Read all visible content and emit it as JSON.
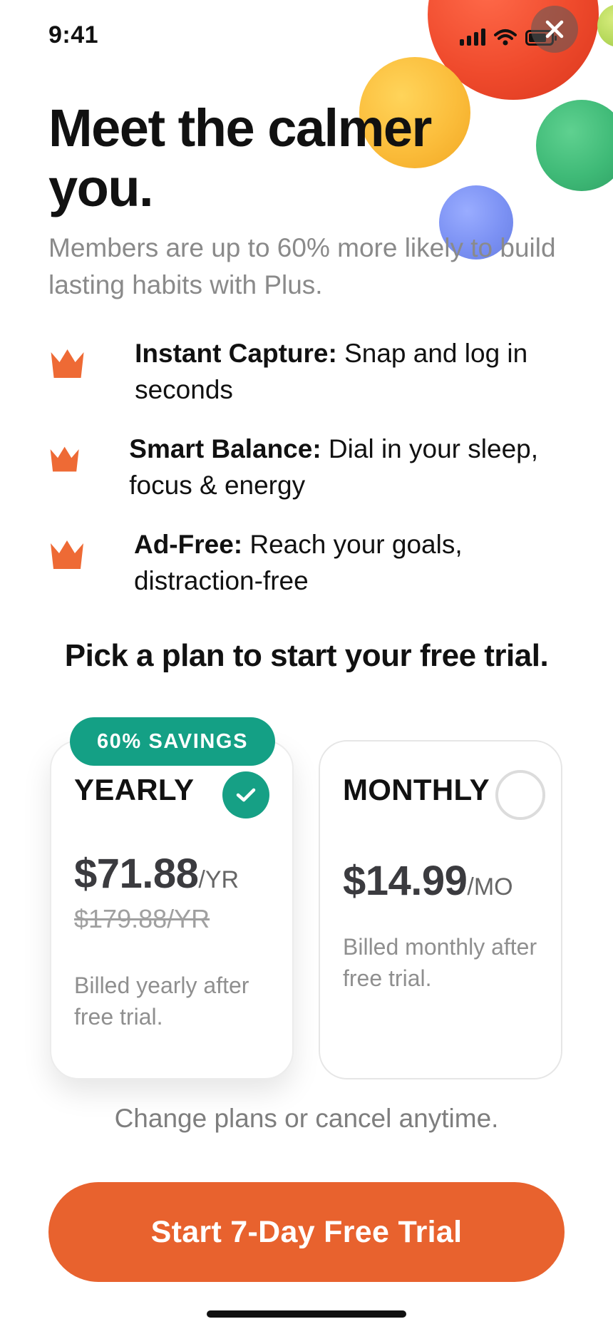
{
  "status_bar": {
    "time": "9:41",
    "icons": [
      "signal-icon",
      "wifi-icon",
      "battery-icon"
    ]
  },
  "close_icon": "close-icon",
  "headline": "Meet the calmer you.",
  "subhead": "Members are up to 60% more likely to build lasting habits with Plus.",
  "features": [
    {
      "icon": "crown-icon",
      "title": "Instant Capture:",
      "desc": " Snap and log in seconds"
    },
    {
      "icon": "crown-icon",
      "title": "Smart Balance:",
      "desc": " Dial in your sleep, focus & energy"
    },
    {
      "icon": "crown-icon",
      "title": "Ad-Free:",
      "desc": " Reach your goals, distraction-free"
    }
  ],
  "pick_plan": "Pick a plan to start your free trial.",
  "plans": {
    "yearly": {
      "badge": "60% SAVINGS",
      "name": "YEARLY",
      "price": "$71.88",
      "unit": "/YR",
      "old_price": "$179.88/YR",
      "billed": "Billed yearly after free trial.",
      "selected": true
    },
    "monthly": {
      "name": "MONTHLY",
      "price": "$14.99",
      "unit": "/MO",
      "billed": "Billed monthly after free trial.",
      "selected": false
    }
  },
  "note": "Change plans or cancel anytime.",
  "cta": "Start 7-Day Free Trial",
  "colors": {
    "accent_orange": "#e8622e",
    "badge_green": "#14a085",
    "crown_orange": "#ee6a35"
  }
}
